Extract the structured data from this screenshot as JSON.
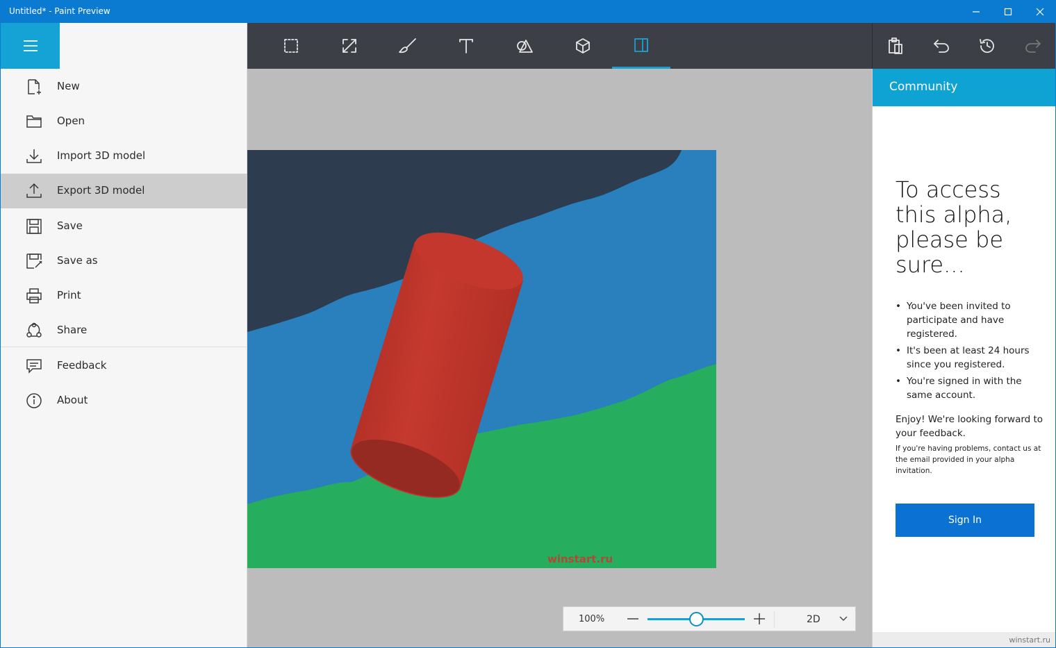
{
  "window": {
    "title": "Untitled* - Paint Preview"
  },
  "colors": {
    "accent": "#15a2d4",
    "titlebar": "#0a7bd1",
    "toolbar": "#3c3f45",
    "signin": "#0b72d3"
  },
  "toolbar": {
    "tools": [
      {
        "name": "select-icon"
      },
      {
        "name": "crop-resize-icon"
      },
      {
        "name": "brush-icon"
      },
      {
        "name": "text-icon"
      },
      {
        "name": "shapes-2d-icon"
      },
      {
        "name": "cube-3d-icon"
      },
      {
        "name": "canvas-icon",
        "active": true
      }
    ],
    "right_tools": [
      {
        "name": "paste-icon"
      },
      {
        "name": "undo-icon"
      },
      {
        "name": "history-icon"
      },
      {
        "name": "redo-icon",
        "disabled": true
      }
    ]
  },
  "menu": {
    "items": [
      {
        "label": "New",
        "icon": "new-file-icon"
      },
      {
        "label": "Open",
        "icon": "folder-icon"
      },
      {
        "label": "Import 3D model",
        "icon": "import-icon"
      },
      {
        "label": "Export 3D model",
        "icon": "export-icon",
        "hover": true
      },
      {
        "label": "Save",
        "icon": "save-icon"
      },
      {
        "label": "Save as",
        "icon": "save-as-icon"
      },
      {
        "label": "Print",
        "icon": "print-icon"
      },
      {
        "label": "Share",
        "icon": "share-icon"
      },
      {
        "label": "Feedback",
        "icon": "feedback-icon"
      },
      {
        "label": "About",
        "icon": "info-icon"
      }
    ]
  },
  "canvas": {
    "watermark": "winstart.ru"
  },
  "zoom": {
    "value": "100%",
    "level": 0.5,
    "mode": "2D"
  },
  "community": {
    "header": "Community",
    "heading": "To access this alpha, please be sure...",
    "bullets": [
      "You've been invited to participate and have registered.",
      "It's been at least 24 hours since you registered.",
      "You're signed in with the same account."
    ],
    "enjoy": "Enjoy! We're looking forward to your feedback.",
    "small": "If you're having problems, contact us at the email provided in your alpha invitation.",
    "signin_label": "Sign In",
    "footer": "winstart.ru"
  }
}
